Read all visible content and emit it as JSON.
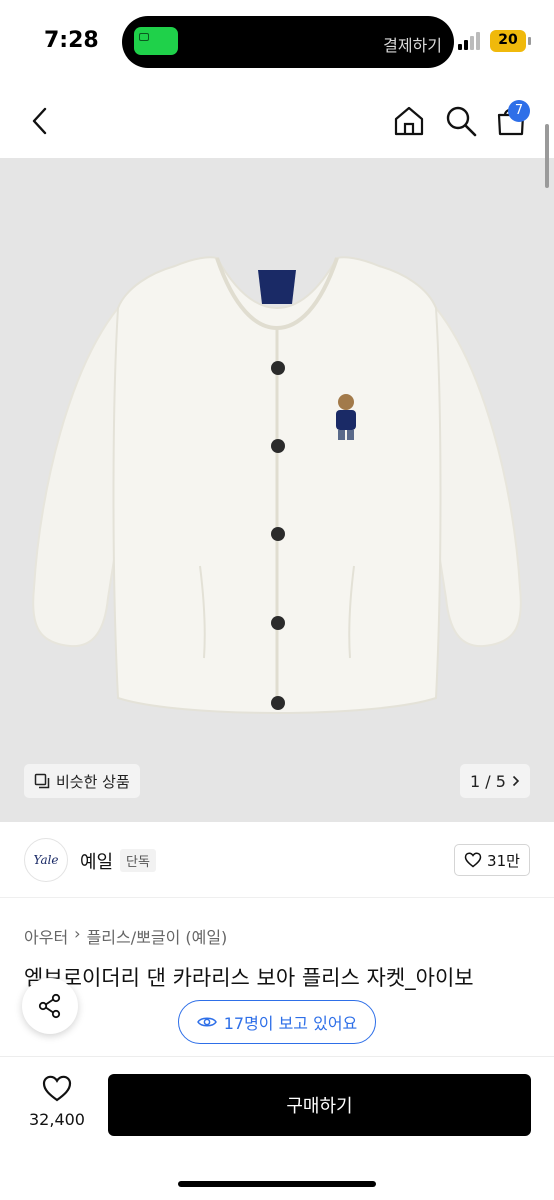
{
  "status": {
    "time": "7:28",
    "island_text": "결제하기",
    "battery": "20"
  },
  "nav": {
    "cart_count": "7",
    "icons": [
      "back-icon",
      "home-icon",
      "search-icon",
      "cart-icon"
    ]
  },
  "hero": {
    "similar_label": "비슷한 상품",
    "page_indicator": "1 / 5",
    "colors": {
      "background": "#e5e5e5",
      "jacket": "#f5f4ef",
      "patch": "#1a2a66"
    }
  },
  "brand": {
    "logo_text": "Yale",
    "name": "예일",
    "tag": "단독",
    "likes": "31만"
  },
  "product": {
    "breadcrumb": [
      "아우터",
      "플리스/뽀글이 (예일)"
    ],
    "title": "엠브로이더리 댄 카라리스 보아 플리스 자켓_아이보",
    "viewers": "17명이 보고 있어요"
  },
  "bottom": {
    "wish_count": "32,400",
    "buy_label": "구매하기"
  },
  "colors": {
    "accent": "#2e6fe8",
    "primary_button": "#000000",
    "pay": "#1fd14a"
  }
}
